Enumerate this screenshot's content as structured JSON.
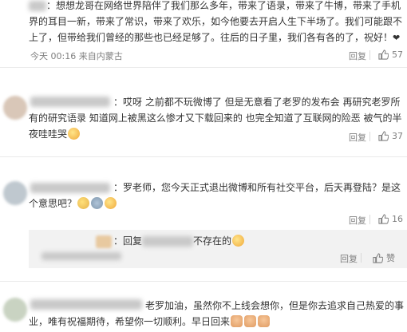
{
  "comments": [
    {
      "text": "：想想龙哥在网络世界陪伴了我们那么多年，带来了语录，带来了牛博，带来了手机界的耳目一新，带来了常识，带来了欢乐，如今他要去开启人生下半场了。我们可能跟不上了，但带给我们曾经的那些也已经足够了。往后的日子里，我们各有各的了，祝好！",
      "time": "今天 00:16 来自内蒙古",
      "reply_label": "回复",
      "likes": "57"
    },
    {
      "text": "：哎呀 之前都不玩微博了 但是无意看了老罗的发布会 再研究老罗所有的研究语录 知道网上被黑这么惨才又下载回来的 也完全知道了互联网的险恶 被气的半夜哇哇哭",
      "reply_label": "回复",
      "likes": "37"
    },
    {
      "text": "：罗老师，您今天正式退出微博和所有社交平台，后天再登陆？是这个意思吧？",
      "reply_label": "回复",
      "likes": "16"
    },
    {
      "reply_prefix": "：回复",
      "text": "不存在的",
      "reply_label": "回复",
      "like_label": "赞"
    },
    {
      "text": "老罗加油，虽然你不上线会想你，但是你去追求自己热爱的事业，唯有祝福期待，希望你一切顺利。早日回来"
    }
  ],
  "colors": {
    "text": "#333333",
    "meta": "#808080",
    "divider": "#eaeaea"
  }
}
